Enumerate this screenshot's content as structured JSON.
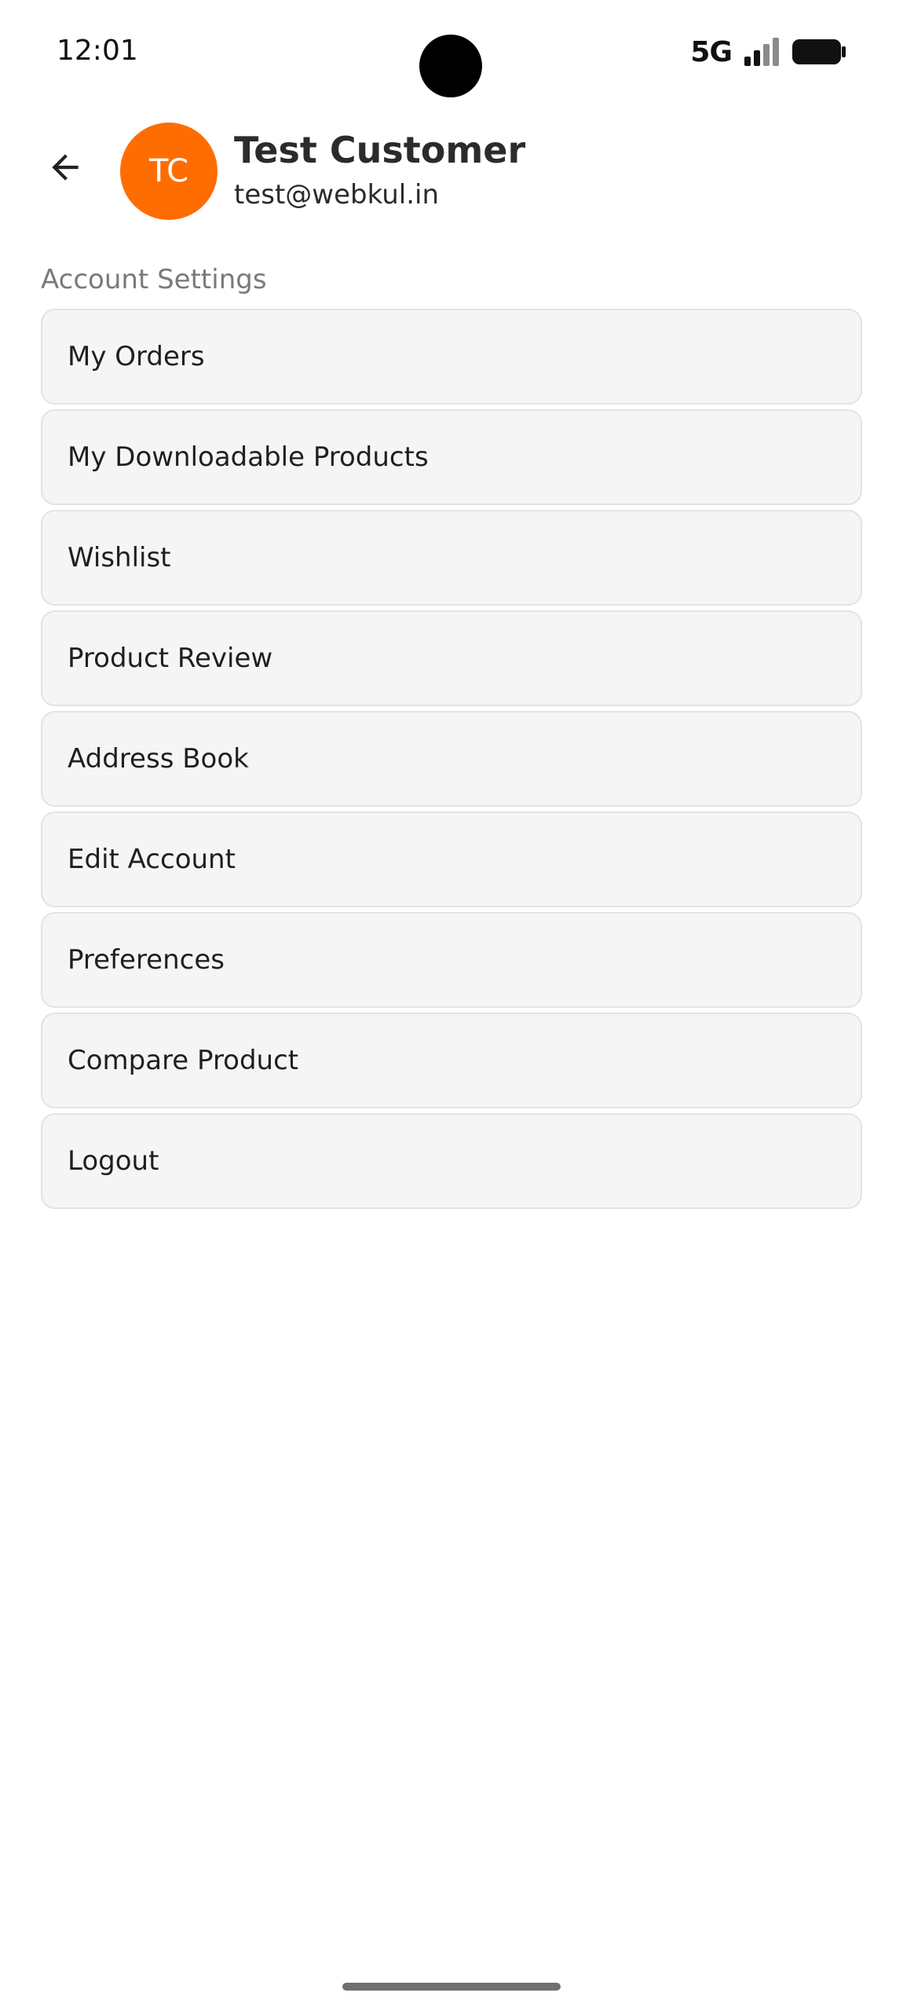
{
  "status_bar": {
    "time": "12:01",
    "network": "5G"
  },
  "header": {
    "avatar_initials": "TC",
    "avatar_color": "#ff6d00",
    "name": "Test Customer",
    "email": "test@webkul.in"
  },
  "section": {
    "title": "Account Settings"
  },
  "menu": {
    "items": [
      {
        "label": "My Orders"
      },
      {
        "label": "My Downloadable Products"
      },
      {
        "label": "Wishlist"
      },
      {
        "label": "Product Review"
      },
      {
        "label": "Address Book"
      },
      {
        "label": "Edit Account"
      },
      {
        "label": "Preferences"
      },
      {
        "label": "Compare Product"
      },
      {
        "label": "Logout"
      }
    ]
  },
  "icons": {
    "back": "arrow-back-icon",
    "signal": "signal-icon",
    "battery": "battery-icon"
  }
}
